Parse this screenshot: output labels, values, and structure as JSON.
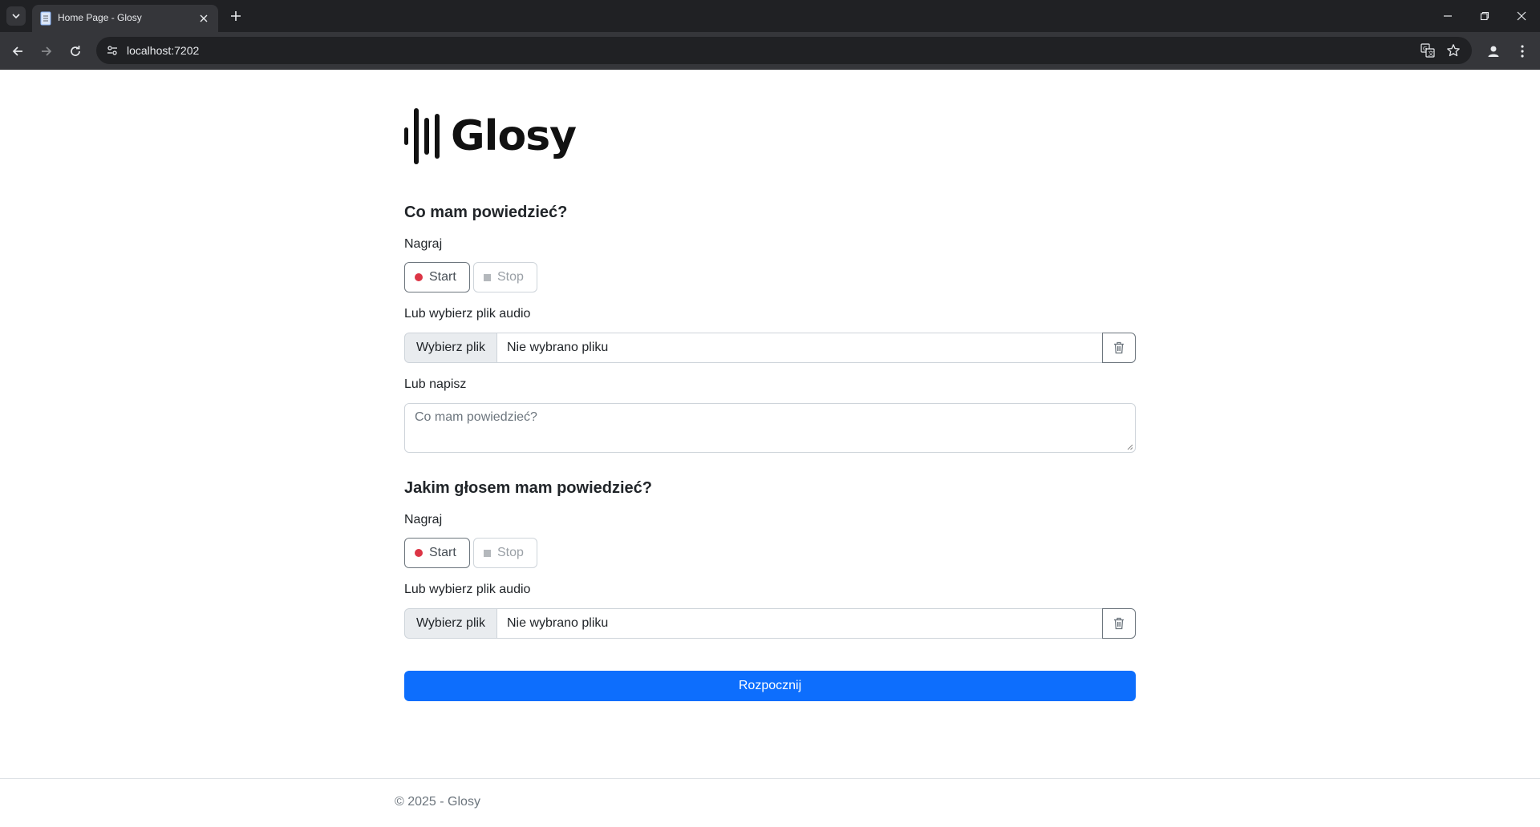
{
  "browser": {
    "tab_title": "Home Page - Glosy",
    "url": "localhost:7202"
  },
  "logo": {
    "text": "Glosy"
  },
  "section1": {
    "heading": "Co mam powiedzieć?",
    "record_label": "Nagraj",
    "start_label": "Start",
    "stop_label": "Stop",
    "file_label": "Lub wybierz plik audio",
    "file_button": "Wybierz plik",
    "file_status": "Nie wybrano pliku",
    "text_label": "Lub napisz",
    "text_placeholder": "Co mam powiedzieć?"
  },
  "section2": {
    "heading": "Jakim głosem mam powiedzieć?",
    "record_label": "Nagraj",
    "start_label": "Start",
    "stop_label": "Stop",
    "file_label": "Lub wybierz plik audio",
    "file_button": "Wybierz plik",
    "file_status": "Nie wybrano pliku"
  },
  "submit_label": "Rozpocznij",
  "footer": {
    "text": "© 2025 - Glosy"
  },
  "colors": {
    "primary": "#0d6efd",
    "record_dot": "#dc3545",
    "chrome_dark": "#202124"
  }
}
